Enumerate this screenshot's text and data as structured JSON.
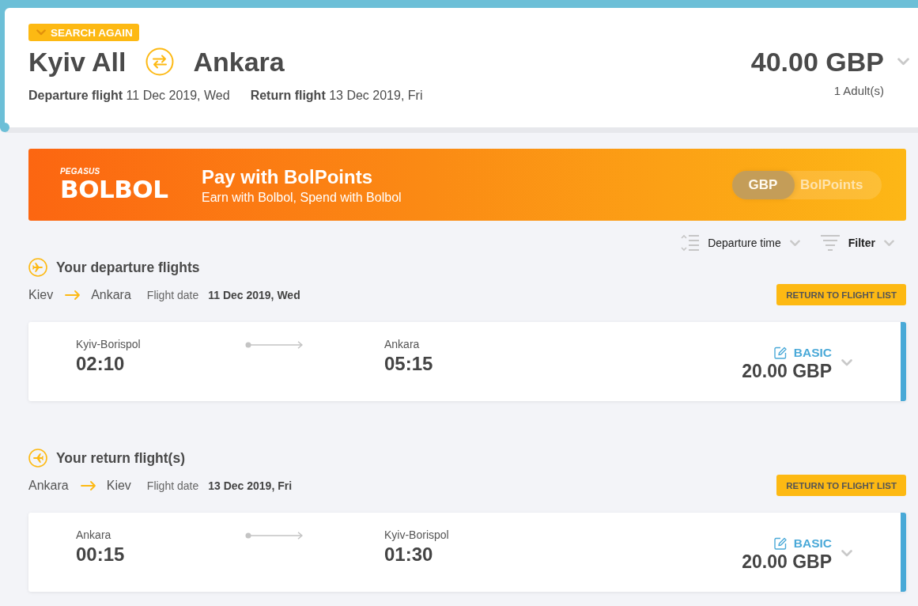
{
  "header": {
    "search_again": "SEARCH AGAIN",
    "origin": "Kyiv All",
    "destination": "Ankara",
    "dates": [
      {
        "label": "Departure flight",
        "value": "11 Dec 2019, Wed"
      },
      {
        "label": "Return flight",
        "value": "13 Dec 2019, Fri"
      }
    ],
    "total_price": "40.00 GBP",
    "passengers": "1 Adult(s)"
  },
  "banner": {
    "logo": {
      "brand": "PEGASUS",
      "wordmark": "BOLBOL"
    },
    "title": "Pay with BolPoints",
    "subtitle": "Earn with Bolbol, Spend with Bolbol",
    "currency_toggle": [
      {
        "label": "GBP",
        "selected": true
      },
      {
        "label": "BolPoints",
        "selected": false
      }
    ]
  },
  "toolbar": {
    "sort": "Departure time",
    "filter": "Filter"
  },
  "sections": [
    {
      "kind": "departure",
      "title": "Your departure flights",
      "from": "Kiev",
      "to": "Ankara",
      "date_label": "Flight date",
      "date": "11 Dec 2019, Wed",
      "return_button": "RETURN TO FLIGHT LIST",
      "flights": [
        {
          "origin": "Kyiv-Borispol",
          "departure_time": "02:10",
          "destination": "Ankara",
          "arrival_time": "05:15",
          "fare": "BASIC",
          "price": "20.00 GBP"
        }
      ]
    },
    {
      "kind": "return",
      "title": "Your return flight(s)",
      "from": "Ankara",
      "to": "Kiev",
      "date_label": "Flight date",
      "date": "13 Dec 2019, Fri",
      "return_button": "RETURN TO FLIGHT LIST",
      "flights": [
        {
          "origin": "Ankara",
          "departure_time": "00:15",
          "destination": "Kyiv-Borispol",
          "arrival_time": "01:30",
          "fare": "BASIC",
          "price": "20.00 GBP"
        }
      ]
    }
  ]
}
